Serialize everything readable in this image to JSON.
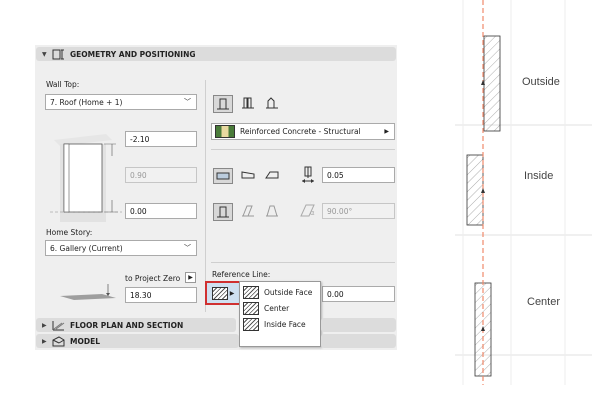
{
  "sections": {
    "geometry": "GEOMETRY AND POSITIONING",
    "floor_plan": "FLOOR PLAN AND SECTION",
    "model": "MODEL"
  },
  "wall_top": {
    "label": "Wall Top:",
    "value": "7. Roof (Home + 1)"
  },
  "top_offset": "-2.10",
  "height_value": "0.90",
  "bottom_offset": "0.00",
  "home_story": {
    "label": "Home Story:",
    "value": "6. Gallery (Current)"
  },
  "to_project_zero": {
    "label": "to Project Zero",
    "value": "18.30"
  },
  "material": "Reinforced Concrete - Structural",
  "thickness": "0.05",
  "angle": "90.00°",
  "reference_line": {
    "label": "Reference Line:",
    "offset": "0.00",
    "options": [
      "Outside Face",
      "Center",
      "Inside Face"
    ]
  },
  "diagram_labels": [
    "Outside",
    "Inside",
    "Center"
  ],
  "colors": {
    "reference_line": "#f08a6b",
    "highlight": "#d03030"
  }
}
